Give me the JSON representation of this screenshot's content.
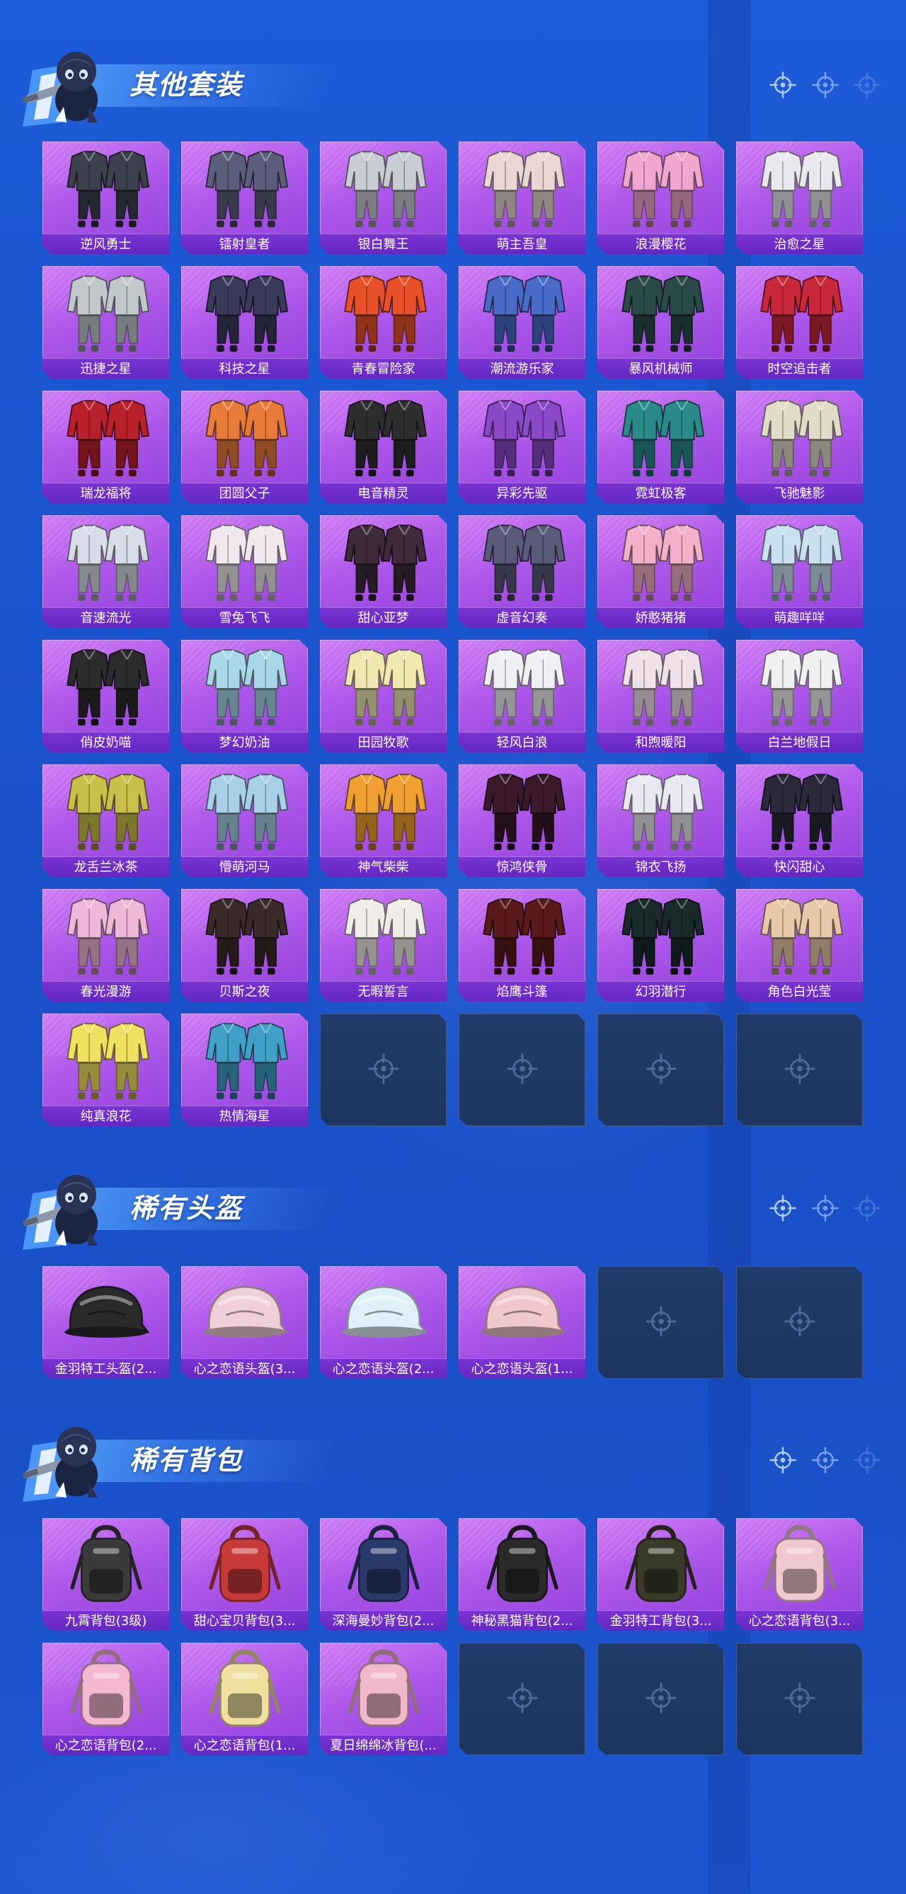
{
  "colors": {
    "background": "#1c58d4",
    "card": "#ad58ea",
    "label_bar": "#6c2bc9",
    "empty_slot": "#1f3966",
    "title_text": "#ffffff"
  },
  "icons": {
    "header_mascot": "mascot-gunner-icon",
    "header_markers": "crosshair-icon",
    "empty_slot": "crosshair-icon"
  },
  "sections": [
    {
      "title": "其他套装",
      "kind": "outfit",
      "empty_slots": 4,
      "items": [
        {
          "name": "逆风勇士",
          "color": "#3c414d"
        },
        {
          "name": "镭射皇者",
          "color": "#5c5f7c"
        },
        {
          "name": "银白舞王",
          "color": "#c9ccd4"
        },
        {
          "name": "萌主吾皇",
          "color": "#ead6d2"
        },
        {
          "name": "浪漫樱花",
          "color": "#f0a6cf"
        },
        {
          "name": "治愈之星",
          "color": "#e8e8ee"
        },
        {
          "name": "迅捷之星",
          "color": "#c0c8cc"
        },
        {
          "name": "科技之星",
          "color": "#3a3a5a"
        },
        {
          "name": "青春冒险家",
          "color": "#e8502a"
        },
        {
          "name": "潮流游乐家",
          "color": "#4a6ac8"
        },
        {
          "name": "暴风机械师",
          "color": "#2a4a4a"
        },
        {
          "name": "时空追击者",
          "color": "#c8283a"
        },
        {
          "name": "瑞龙福将",
          "color": "#b8202a"
        },
        {
          "name": "团圆父子",
          "color": "#e87a3a"
        },
        {
          "name": "电音精灵",
          "color": "#2e2e2e"
        },
        {
          "name": "异彩先驱",
          "color": "#8a4ac8"
        },
        {
          "name": "霓虹极客",
          "color": "#2a8a8a"
        },
        {
          "name": "飞驰魅影",
          "color": "#e0dcc8"
        },
        {
          "name": "音速流光",
          "color": "#d8dce8"
        },
        {
          "name": "雪兔飞飞",
          "color": "#f0e8ec"
        },
        {
          "name": "甜心亚梦",
          "color": "#3e2a3a"
        },
        {
          "name": "虚音幻奏",
          "color": "#5a5a7a"
        },
        {
          "name": "娇憨猪猪",
          "color": "#f4b0c8"
        },
        {
          "name": "萌趣咩咩",
          "color": "#c8e0f0"
        },
        {
          "name": "俏皮奶喵",
          "color": "#2c2c2c"
        },
        {
          "name": "梦幻奶油",
          "color": "#a8d8e8"
        },
        {
          "name": "田园牧歌",
          "color": "#f0e8b0"
        },
        {
          "name": "轻风白浪",
          "color": "#f0f0f4"
        },
        {
          "name": "和煦暖阳",
          "color": "#f0e0e8"
        },
        {
          "name": "白兰地假日",
          "color": "#f0f0f0"
        },
        {
          "name": "龙舌兰冰茶",
          "color": "#c8c048"
        },
        {
          "name": "懵萌河马",
          "color": "#a8d0e8"
        },
        {
          "name": "神气柴柴",
          "color": "#f0a030"
        },
        {
          "name": "惊鸿侠骨",
          "color": "#3a1a2a"
        },
        {
          "name": "锦衣飞扬",
          "color": "#e8e8f0"
        },
        {
          "name": "快闪甜心",
          "color": "#2a2a3a"
        },
        {
          "name": "春光漫游",
          "color": "#f0b8d8"
        },
        {
          "name": "贝斯之夜",
          "color": "#3a2a2a"
        },
        {
          "name": "无暇誓言",
          "color": "#f0ece8"
        },
        {
          "name": "焰鹰斗篷",
          "color": "#5a1a1a"
        },
        {
          "name": "幻羽潜行",
          "color": "#1a2a2a"
        },
        {
          "name": "角色白光莹",
          "color": "#e8c8a8"
        },
        {
          "name": "纯真浪花",
          "color": "#f0e060"
        },
        {
          "name": "热情海星",
          "color": "#40a0c8"
        }
      ]
    },
    {
      "title": "稀有头盔",
      "kind": "helmet",
      "empty_slots": 2,
      "items": [
        {
          "name": "金羽特工头盔(2...",
          "color": "#2a2a2a"
        },
        {
          "name": "心之恋语头盔(3...",
          "color": "#f0d0d8"
        },
        {
          "name": "心之恋语头盔(2...",
          "color": "#e0f0f8"
        },
        {
          "name": "心之恋语头盔(1...",
          "color": "#f0c8cc"
        }
      ]
    },
    {
      "title": "稀有背包",
      "kind": "backpack",
      "empty_slots": 3,
      "items": [
        {
          "name": "九霄背包(3级)",
          "color": "#3a3a3a"
        },
        {
          "name": "甜心宝贝背包(3...",
          "color": "#c83a3a"
        },
        {
          "name": "深海曼妙背包(2...",
          "color": "#2a3a6a"
        },
        {
          "name": "神秘黑猫背包(2...",
          "color": "#2a2a2a"
        },
        {
          "name": "金羽特工背包(3...",
          "color": "#3a3a2a"
        },
        {
          "name": "心之恋语背包(3...",
          "color": "#f0c8d0"
        },
        {
          "name": "心之恋语背包(2...",
          "color": "#f4b8d0"
        },
        {
          "name": "心之恋语背包(1...",
          "color": "#f0e0a0"
        },
        {
          "name": "夏日绵绵冰背包(...",
          "color": "#f0b8c8"
        }
      ]
    }
  ]
}
